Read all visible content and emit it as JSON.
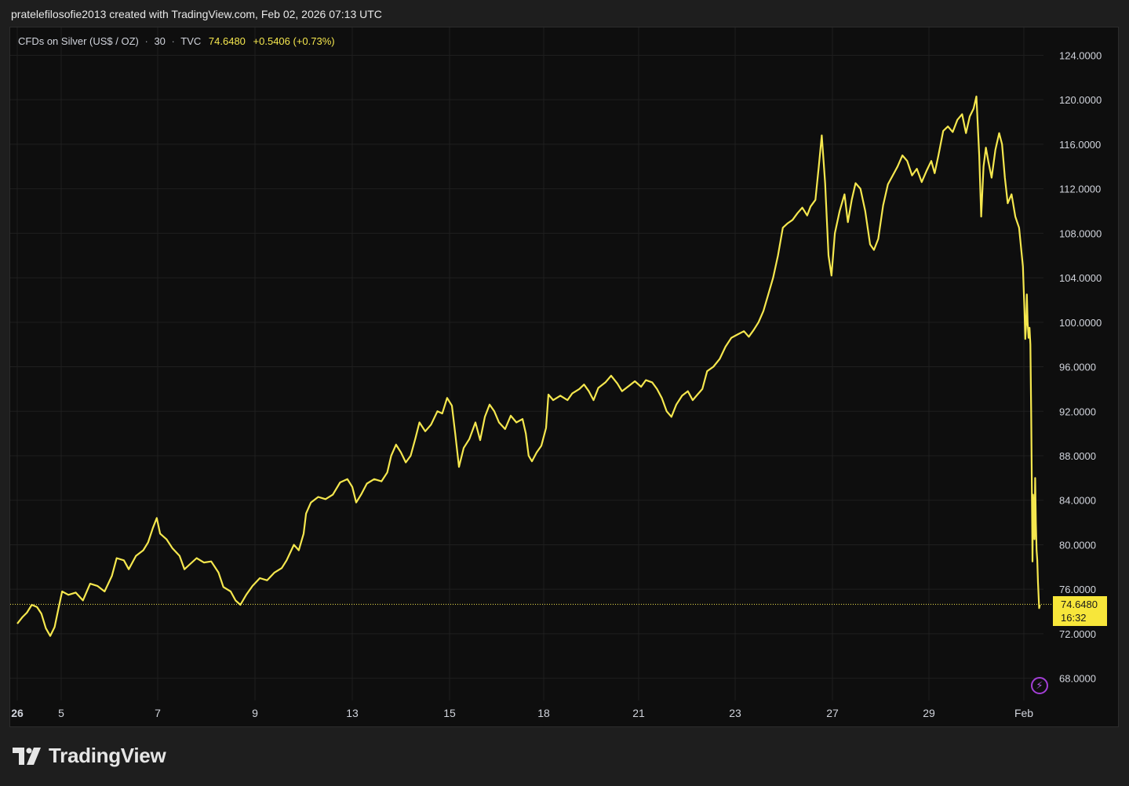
{
  "caption": "pratelefilosofie2013 created with TradingView.com, Feb 02, 2026 07:13 UTC",
  "legend": {
    "symbol": "CFDs on Silver (US$ / OZ)",
    "interval": "30",
    "source": "TVC",
    "price": "74.6480",
    "change": "+0.5406",
    "change_pct": "(+0.73%)"
  },
  "price_tag": {
    "price": "74.6480",
    "countdown": "16:32"
  },
  "brand": {
    "name": "TradingView"
  },
  "colors": {
    "line": "#f5e74e",
    "background": "#0e0e0e",
    "grid": "#1f1f1f",
    "axis_text": "#d1d4dc",
    "tag": "#f7e63a"
  },
  "icons": {
    "brand_logo": "tradingview-logo-icon",
    "alert": "lightning-icon"
  },
  "chart_data": {
    "type": "line",
    "title": "",
    "xlabel": "",
    "ylabel": "",
    "ylim": [
      66.0,
      126.5
    ],
    "y_ticks": [
      "124.0000",
      "120.0000",
      "116.0000",
      "112.0000",
      "108.0000",
      "104.0000",
      "100.0000",
      "96.0000",
      "92.0000",
      "88.0000",
      "84.0000",
      "80.0000",
      "76.0000",
      "72.0000",
      "68.0000"
    ],
    "y_tick_values": [
      124,
      120,
      116,
      112,
      108,
      104,
      100,
      96,
      92,
      88,
      84,
      80,
      76,
      72,
      68
    ],
    "x_ticks": [
      {
        "label": "26",
        "day": 0
      },
      {
        "label": "5",
        "day": 1
      },
      {
        "label": "7",
        "day": 3
      },
      {
        "label": "9",
        "day": 5
      },
      {
        "label": "13",
        "day": 7
      },
      {
        "label": "15",
        "day": 9
      },
      {
        "label": "18",
        "day": 11
      },
      {
        "label": "21",
        "day": 13
      },
      {
        "label": "23",
        "day": 15
      },
      {
        "label": "27",
        "day": 17
      },
      {
        "label": "29",
        "day": 19
      },
      {
        "label": "Feb",
        "day": 21
      }
    ],
    "grid": true,
    "last_price": 74.648,
    "series": [
      {
        "values": [
          [
            0.0,
            72.9
          ],
          [
            0.12,
            73.5
          ],
          [
            0.22,
            73.9
          ],
          [
            0.33,
            74.6
          ],
          [
            0.45,
            74.4
          ],
          [
            0.55,
            73.8
          ],
          [
            0.65,
            72.5
          ],
          [
            0.75,
            71.8
          ],
          [
            0.85,
            72.6
          ],
          [
            0.95,
            74.5
          ],
          [
            1.02,
            75.8
          ],
          [
            1.15,
            75.5
          ],
          [
            1.3,
            75.7
          ],
          [
            1.45,
            75.0
          ],
          [
            1.6,
            76.5
          ],
          [
            1.75,
            76.3
          ],
          [
            1.9,
            75.8
          ],
          [
            2.05,
            77.2
          ],
          [
            2.15,
            78.8
          ],
          [
            2.3,
            78.6
          ],
          [
            2.4,
            77.8
          ],
          [
            2.55,
            79.0
          ],
          [
            2.7,
            79.5
          ],
          [
            2.8,
            80.2
          ],
          [
            2.9,
            81.5
          ],
          [
            2.98,
            82.4
          ],
          [
            3.05,
            81.0
          ],
          [
            3.18,
            80.5
          ],
          [
            3.3,
            79.7
          ],
          [
            3.45,
            79.0
          ],
          [
            3.55,
            77.8
          ],
          [
            3.65,
            78.2
          ],
          [
            3.8,
            78.8
          ],
          [
            3.95,
            78.4
          ],
          [
            4.1,
            78.5
          ],
          [
            4.25,
            77.5
          ],
          [
            4.35,
            76.2
          ],
          [
            4.5,
            75.8
          ],
          [
            4.6,
            75.0
          ],
          [
            4.7,
            74.6
          ],
          [
            4.82,
            75.5
          ],
          [
            4.95,
            76.3
          ],
          [
            5.1,
            77.0
          ],
          [
            5.25,
            76.8
          ],
          [
            5.4,
            77.5
          ],
          [
            5.55,
            77.9
          ],
          [
            5.65,
            78.6
          ],
          [
            5.8,
            80.0
          ],
          [
            5.9,
            79.5
          ],
          [
            6.0,
            81.0
          ],
          [
            6.05,
            82.8
          ],
          [
            6.15,
            83.8
          ],
          [
            6.3,
            84.3
          ],
          [
            6.45,
            84.1
          ],
          [
            6.6,
            84.5
          ],
          [
            6.75,
            85.6
          ],
          [
            6.9,
            85.9
          ],
          [
            7.0,
            85.2
          ],
          [
            7.08,
            83.8
          ],
          [
            7.18,
            84.5
          ],
          [
            7.3,
            85.5
          ],
          [
            7.45,
            85.9
          ],
          [
            7.6,
            85.7
          ],
          [
            7.72,
            86.5
          ],
          [
            7.8,
            88.0
          ],
          [
            7.9,
            89.0
          ],
          [
            8.0,
            88.3
          ],
          [
            8.1,
            87.4
          ],
          [
            8.2,
            88.0
          ],
          [
            8.3,
            89.6
          ],
          [
            8.38,
            91.0
          ],
          [
            8.5,
            90.2
          ],
          [
            8.62,
            90.8
          ],
          [
            8.75,
            92.0
          ],
          [
            8.85,
            91.8
          ],
          [
            8.95,
            93.2
          ],
          [
            9.05,
            92.5
          ],
          [
            9.12,
            90.0
          ],
          [
            9.2,
            87.0
          ],
          [
            9.3,
            88.7
          ],
          [
            9.42,
            89.5
          ],
          [
            9.55,
            91.0
          ],
          [
            9.65,
            89.4
          ],
          [
            9.75,
            91.5
          ],
          [
            9.85,
            92.6
          ],
          [
            9.95,
            92.0
          ],
          [
            10.05,
            91.0
          ],
          [
            10.18,
            90.4
          ],
          [
            10.3,
            91.6
          ],
          [
            10.42,
            91.0
          ],
          [
            10.55,
            91.3
          ],
          [
            10.62,
            90.0
          ],
          [
            10.68,
            88.0
          ],
          [
            10.75,
            87.5
          ],
          [
            10.85,
            88.3
          ],
          [
            10.95,
            88.9
          ],
          [
            11.05,
            90.5
          ],
          [
            11.1,
            93.5
          ],
          [
            11.2,
            93.0
          ],
          [
            11.35,
            93.4
          ],
          [
            11.5,
            93.0
          ],
          [
            11.6,
            93.6
          ],
          [
            11.75,
            94.0
          ],
          [
            11.85,
            94.4
          ],
          [
            11.95,
            93.8
          ],
          [
            12.05,
            93.0
          ],
          [
            12.15,
            94.1
          ],
          [
            12.3,
            94.6
          ],
          [
            12.42,
            95.2
          ],
          [
            12.55,
            94.5
          ],
          [
            12.65,
            93.8
          ],
          [
            12.8,
            94.3
          ],
          [
            12.92,
            94.7
          ],
          [
            13.05,
            94.2
          ],
          [
            13.15,
            94.8
          ],
          [
            13.28,
            94.6
          ],
          [
            13.38,
            94.0
          ],
          [
            13.48,
            93.2
          ],
          [
            13.58,
            92.0
          ],
          [
            13.68,
            91.5
          ],
          [
            13.78,
            92.6
          ],
          [
            13.9,
            93.4
          ],
          [
            14.02,
            93.8
          ],
          [
            14.12,
            93.0
          ],
          [
            14.22,
            93.5
          ],
          [
            14.32,
            94.0
          ],
          [
            14.42,
            95.6
          ],
          [
            14.55,
            96.0
          ],
          [
            14.68,
            96.7
          ],
          [
            14.8,
            97.8
          ],
          [
            14.92,
            98.6
          ],
          [
            15.05,
            98.9
          ],
          [
            15.18,
            99.2
          ],
          [
            15.28,
            98.7
          ],
          [
            15.38,
            99.3
          ],
          [
            15.48,
            100.0
          ],
          [
            15.58,
            101.0
          ],
          [
            15.68,
            102.5
          ],
          [
            15.78,
            104.0
          ],
          [
            15.88,
            106.0
          ],
          [
            15.98,
            108.5
          ],
          [
            16.08,
            108.9
          ],
          [
            16.18,
            109.2
          ],
          [
            16.28,
            109.8
          ],
          [
            16.38,
            110.3
          ],
          [
            16.48,
            109.6
          ],
          [
            16.55,
            110.4
          ],
          [
            16.65,
            111.0
          ],
          [
            16.72,
            114.0
          ],
          [
            16.78,
            116.8
          ],
          [
            16.85,
            112.5
          ],
          [
            16.92,
            106.0
          ],
          [
            16.98,
            104.2
          ],
          [
            17.05,
            108.0
          ],
          [
            17.15,
            110.0
          ],
          [
            17.25,
            111.5
          ],
          [
            17.32,
            109.0
          ],
          [
            17.4,
            111.0
          ],
          [
            17.48,
            112.5
          ],
          [
            17.58,
            112.0
          ],
          [
            17.68,
            110.0
          ],
          [
            17.78,
            107.0
          ],
          [
            17.86,
            106.5
          ],
          [
            17.95,
            107.5
          ],
          [
            18.05,
            110.5
          ],
          [
            18.15,
            112.4
          ],
          [
            18.25,
            113.2
          ],
          [
            18.35,
            114.0
          ],
          [
            18.45,
            115.0
          ],
          [
            18.55,
            114.5
          ],
          [
            18.65,
            113.2
          ],
          [
            18.75,
            113.8
          ],
          [
            18.85,
            112.6
          ],
          [
            18.95,
            113.6
          ],
          [
            19.05,
            114.5
          ],
          [
            19.12,
            113.4
          ],
          [
            19.2,
            115.0
          ],
          [
            19.3,
            117.2
          ],
          [
            19.4,
            117.6
          ],
          [
            19.5,
            117.1
          ],
          [
            19.6,
            118.2
          ],
          [
            19.7,
            118.7
          ],
          [
            19.78,
            117.0
          ],
          [
            19.86,
            118.5
          ],
          [
            19.94,
            119.2
          ],
          [
            20.0,
            120.3
          ],
          [
            20.06,
            115.0
          ],
          [
            20.1,
            109.5
          ],
          [
            20.15,
            114.0
          ],
          [
            20.2,
            115.7
          ],
          [
            20.25,
            114.5
          ],
          [
            20.32,
            113.0
          ],
          [
            20.4,
            115.5
          ],
          [
            20.48,
            117.0
          ],
          [
            20.54,
            116.0
          ],
          [
            20.6,
            113.0
          ],
          [
            20.66,
            110.7
          ],
          [
            20.74,
            111.5
          ],
          [
            20.82,
            109.5
          ],
          [
            20.9,
            108.5
          ],
          [
            20.98,
            105.0
          ],
          [
            21.05,
            101.0
          ],
          [
            21.12,
            98.5
          ],
          [
            21.2,
            100.0
          ],
          [
            21.25,
            102.5
          ],
          [
            21.32,
            100.0
          ],
          [
            21.4,
            98.6
          ],
          [
            21.48,
            99.5
          ],
          [
            21.55,
            98.0
          ],
          [
            21.62,
            92.0
          ],
          [
            21.68,
            85.0
          ],
          [
            21.73,
            78.5
          ],
          [
            21.78,
            84.5
          ],
          [
            21.85,
            83.0
          ],
          [
            21.9,
            80.5
          ],
          [
            21.96,
            86.0
          ],
          [
            22.02,
            82.0
          ],
          [
            22.08,
            79.5
          ],
          [
            22.14,
            78.6
          ],
          [
            22.2,
            76.6
          ],
          [
            22.26,
            75.2
          ],
          [
            22.3,
            74.3
          ],
          [
            22.36,
            74.6
          ]
        ]
      }
    ]
  }
}
